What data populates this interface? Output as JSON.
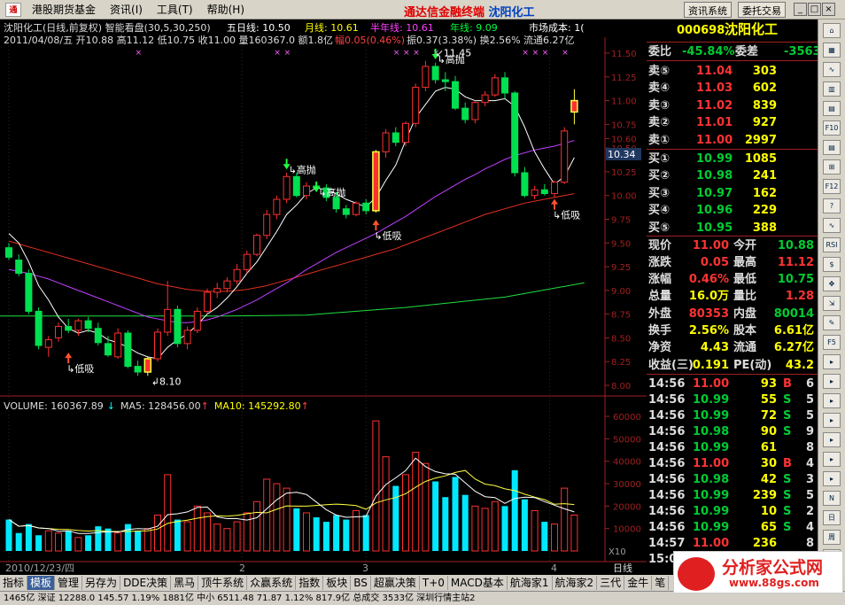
{
  "titlebar": {
    "menus": [
      "港股期货基金",
      "资讯(I)",
      "工具(T)",
      "帮助(H)"
    ],
    "title": "通达信金融终端",
    "stock": "沈阳化工",
    "btn_news": "资讯系统",
    "btn_trade": "委托交易"
  },
  "header": {
    "line1": "沈阳化工(日线,前复权) 智能看盘(30,5,30,250)",
    "ma5": "五日线: 10.50",
    "ma20": "月线: 10.61",
    "ma120": "半年线: 10.61",
    "ma250": "年线: 9.09",
    "cost": "市场成本: 1(",
    "line2a": "2011/04/08/五 开10.88 高11.12 低10.75 收11.00 量160367.0 额1.8亿",
    "line2b": "幅0.05(0.46%)",
    "line2c": "振0.37(3.38%) 换2.56% 流通6.27亿"
  },
  "price_axis": [
    "11.50",
    "11.25",
    "11.00",
    "10.75",
    "10.60",
    "10.50",
    "10.25",
    "10.00",
    "9.75",
    "9.50",
    "9.25",
    "9.00",
    "8.75",
    "8.50",
    "8.25",
    "8.00"
  ],
  "price_tag": "10.34",
  "vol_axis": [
    "60000",
    "50000",
    "40000",
    "30000",
    "20000",
    "10000"
  ],
  "vol_unit": "X10",
  "vol_header": {
    "a": "VOLUME: 160367.89",
    "b": "MA5: 128456.00",
    "c": "MA10: 145292.80"
  },
  "dates": {
    "first": "2010/12/23/四",
    "m2": "2",
    "m3": "3",
    "m4": "4"
  },
  "annotations": {
    "low": "低吸",
    "high": "高抛",
    "top": "11.45",
    "bottom": "8.10"
  },
  "chart_data": {
    "type": "candlestick",
    "candles": [
      [
        9.45,
        9.5,
        9.32,
        9.35
      ],
      [
        9.32,
        9.38,
        9.15,
        9.18
      ],
      [
        9.18,
        9.22,
        8.75,
        8.78
      ],
      [
        8.78,
        8.82,
        8.38,
        8.42
      ],
      [
        8.4,
        8.52,
        8.3,
        8.48
      ],
      [
        8.5,
        8.66,
        8.46,
        8.62
      ],
      [
        8.62,
        8.7,
        8.55,
        8.58
      ],
      [
        8.58,
        8.7,
        8.52,
        8.68
      ],
      [
        8.68,
        8.72,
        8.56,
        8.6
      ],
      [
        8.6,
        8.66,
        8.42,
        8.45
      ],
      [
        8.44,
        8.52,
        8.3,
        8.32
      ],
      [
        8.3,
        8.6,
        8.28,
        8.55
      ],
      [
        8.55,
        8.58,
        8.18,
        8.2
      ],
      [
        8.2,
        8.26,
        8.1,
        8.14
      ],
      [
        8.14,
        8.3,
        8.1,
        8.28
      ],
      [
        8.28,
        8.6,
        8.25,
        8.56
      ],
      [
        8.56,
        9.1,
        8.52,
        8.8
      ],
      [
        8.8,
        8.84,
        8.4,
        8.44
      ],
      [
        8.44,
        8.62,
        8.38,
        8.58
      ],
      [
        8.58,
        8.82,
        8.55,
        8.78
      ],
      [
        8.78,
        9.02,
        8.75,
        8.98
      ],
      [
        8.98,
        9.08,
        8.92,
        9.02
      ],
      [
        9.02,
        9.14,
        8.98,
        9.1
      ],
      [
        9.1,
        9.28,
        9.06,
        9.22
      ],
      [
        9.22,
        9.42,
        9.18,
        9.38
      ],
      [
        9.38,
        9.6,
        9.36,
        9.58
      ],
      [
        9.58,
        9.85,
        9.54,
        9.8
      ],
      [
        9.8,
        10.0,
        9.75,
        9.96
      ],
      [
        9.96,
        10.24,
        9.92,
        10.2
      ],
      [
        10.2,
        10.24,
        9.98,
        10.0
      ],
      [
        10.0,
        10.14,
        9.96,
        10.1
      ],
      [
        10.1,
        10.14,
        10.04,
        10.08
      ],
      [
        10.08,
        10.12,
        9.94,
        9.98
      ],
      [
        9.98,
        10.04,
        9.82,
        9.86
      ],
      [
        9.86,
        9.9,
        9.76,
        9.8
      ],
      [
        9.8,
        9.94,
        9.78,
        9.92
      ],
      [
        9.92,
        9.96,
        9.8,
        9.84
      ],
      [
        9.84,
        10.48,
        9.82,
        10.46
      ],
      [
        10.46,
        10.7,
        10.4,
        10.66
      ],
      [
        10.66,
        10.72,
        10.52,
        10.56
      ],
      [
        10.56,
        10.78,
        10.52,
        10.76
      ],
      [
        10.76,
        11.18,
        10.72,
        11.14
      ],
      [
        11.14,
        11.42,
        11.1,
        11.36
      ],
      [
        11.36,
        11.4,
        11.18,
        11.22
      ],
      [
        11.22,
        11.3,
        11.1,
        11.2
      ],
      [
        11.2,
        11.26,
        10.9,
        10.92
      ],
      [
        10.92,
        10.98,
        10.76,
        10.8
      ],
      [
        10.8,
        11.0,
        10.76,
        10.98
      ],
      [
        10.98,
        11.1,
        10.94,
        11.06
      ],
      [
        11.06,
        11.28,
        11.04,
        11.24
      ],
      [
        11.24,
        11.3,
        11.02,
        11.08
      ],
      [
        11.08,
        11.1,
        10.2,
        10.24
      ],
      [
        10.24,
        10.3,
        9.98,
        10.0
      ],
      [
        10.0,
        10.1,
        9.96,
        10.06
      ],
      [
        10.06,
        10.12,
        10.0,
        10.02
      ],
      [
        10.02,
        10.16,
        9.98,
        10.14
      ],
      [
        10.14,
        10.72,
        10.12,
        10.68
      ],
      [
        10.88,
        11.12,
        10.75,
        11.0
      ]
    ],
    "ma5": [
      9.6,
      9.5,
      9.3,
      9.05,
      8.9,
      8.72,
      8.6,
      8.55,
      8.58,
      8.55,
      8.48,
      8.45,
      8.4,
      8.34,
      8.3,
      8.28,
      8.4,
      8.48,
      8.54,
      8.64,
      8.75,
      8.82,
      8.92,
      9.04,
      9.18,
      9.3,
      9.46,
      9.62,
      9.8,
      9.9,
      10.02,
      10.08,
      10.06,
      10.02,
      9.96,
      9.92,
      9.88,
      9.98,
      10.16,
      10.32,
      10.58,
      10.82,
      10.96,
      11.1,
      11.14,
      11.12,
      11.04,
      11.0,
      11.0,
      11.0,
      11.02,
      10.94,
      10.72,
      10.46,
      10.28,
      10.12,
      10.2,
      10.4
    ],
    "ma30": [
      9.22,
      9.2,
      9.18,
      9.15,
      9.12,
      9.08,
      9.04,
      9.0,
      8.96,
      8.92,
      8.88,
      8.84,
      8.8,
      8.76,
      8.72,
      8.7,
      8.68,
      8.66,
      8.66,
      8.67,
      8.69,
      8.72,
      8.76,
      8.8,
      8.85,
      8.9,
      8.96,
      9.02,
      9.08,
      9.15,
      9.22,
      9.28,
      9.34,
      9.4,
      9.45,
      9.5,
      9.55,
      9.6,
      9.66,
      9.72,
      9.78,
      9.85,
      9.92,
      9.99,
      10.05,
      10.11,
      10.17,
      10.22,
      10.28,
      10.33,
      10.38,
      10.42,
      10.45,
      10.48,
      10.5,
      10.52,
      10.55,
      10.58
    ],
    "ma_red": [
      9.52,
      9.49,
      9.46,
      9.43,
      9.4,
      9.37,
      9.34,
      9.31,
      9.28,
      9.25,
      9.22,
      9.19,
      9.16,
      9.13,
      9.1,
      9.07,
      9.05,
      9.03,
      9.01,
      9.0,
      8.99,
      8.99,
      8.99,
      9.0,
      9.01,
      9.03,
      9.05,
      9.08,
      9.11,
      9.14,
      9.17,
      9.2,
      9.23,
      9.26,
      9.29,
      9.32,
      9.35,
      9.38,
      9.41,
      9.44,
      9.48,
      9.52,
      9.56,
      9.6,
      9.64,
      9.68,
      9.72,
      9.76,
      9.8,
      9.83,
      9.86,
      9.89,
      9.92,
      9.94,
      9.96,
      9.98,
      10.0,
      10.02
    ],
    "ma_green": [
      [
        0,
        8.73
      ],
      [
        22,
        8.73
      ],
      [
        30,
        8.74
      ],
      [
        40,
        8.82
      ],
      [
        50,
        8.93
      ],
      [
        58,
        9.08
      ]
    ],
    "volume": [
      14000,
      8000,
      12000,
      7000,
      9000,
      8000,
      9000,
      6000,
      7000,
      11000,
      10000,
      8000,
      12000,
      9000,
      10000,
      16000,
      34000,
      14000,
      13000,
      20000,
      17000,
      12000,
      10000,
      13000,
      17000,
      22000,
      32000,
      30000,
      28000,
      19000,
      17000,
      15000,
      13000,
      16000,
      14000,
      18000,
      16000,
      58000,
      42000,
      29000,
      34000,
      44000,
      39000,
      31000,
      24000,
      33000,
      25000,
      20000,
      19000,
      22000,
      20000,
      36000,
      23000,
      18000,
      13000,
      12000,
      28000,
      16000
    ]
  },
  "quote": {
    "code": "000698",
    "name": "沈阳化工",
    "wb_label": "委比",
    "wb": "-45.84%",
    "wc_label": "委差",
    "wc": "-3563",
    "sells": [
      {
        "l": "卖⑤",
        "p": "11.04",
        "v": "303"
      },
      {
        "l": "卖④",
        "p": "11.03",
        "v": "602"
      },
      {
        "l": "卖③",
        "p": "11.02",
        "v": "839"
      },
      {
        "l": "卖②",
        "p": "11.01",
        "v": "927"
      },
      {
        "l": "卖①",
        "p": "11.00",
        "v": "2997"
      }
    ],
    "buys": [
      {
        "l": "买①",
        "p": "10.99",
        "v": "1085"
      },
      {
        "l": "买②",
        "p": "10.98",
        "v": "241"
      },
      {
        "l": "买③",
        "p": "10.97",
        "v": "162"
      },
      {
        "l": "买④",
        "p": "10.96",
        "v": "229"
      },
      {
        "l": "买⑤",
        "p": "10.95",
        "v": "388"
      }
    ],
    "stats": [
      {
        "l1": "现价",
        "v1": "11.00",
        "c1": "up",
        "l2": "今开",
        "v2": "10.88",
        "c2": "dn"
      },
      {
        "l1": "涨跌",
        "v1": "0.05",
        "c1": "up",
        "l2": "最高",
        "v2": "11.12",
        "c2": "up"
      },
      {
        "l1": "涨幅",
        "v1": "0.46%",
        "c1": "up",
        "l2": "最低",
        "v2": "10.75",
        "c2": "dn"
      },
      {
        "l1": "总量",
        "v1": "16.0万",
        "c1": "yl",
        "l2": "量比",
        "v2": "1.28",
        "c2": "up"
      },
      {
        "l1": "外盘",
        "v1": "80353",
        "c1": "up",
        "l2": "内盘",
        "v2": "80014",
        "c2": "dn"
      },
      {
        "l1": "换手",
        "v1": "2.56%",
        "c1": "yl",
        "l2": "股本",
        "v2": "6.61亿",
        "c2": "yl"
      },
      {
        "l1": "净资",
        "v1": "4.43",
        "c1": "yl",
        "l2": "流通",
        "v2": "6.27亿",
        "c2": "yl"
      },
      {
        "l1": "收益(三)",
        "v1": "0.191",
        "c1": "yl",
        "l2": "PE(动)",
        "v2": "43.2",
        "c2": "yl"
      }
    ],
    "ticks": [
      {
        "t": "14:56",
        "p": "11.00",
        "v": "93",
        "d": "B",
        "n": "6"
      },
      {
        "t": "14:56",
        "p": "10.99",
        "v": "55",
        "d": "S",
        "n": "5"
      },
      {
        "t": "14:56",
        "p": "10.99",
        "v": "72",
        "d": "S",
        "n": "5"
      },
      {
        "t": "14:56",
        "p": "10.98",
        "v": "90",
        "d": "S",
        "n": "9"
      },
      {
        "t": "14:56",
        "p": "10.99",
        "v": "61",
        "d": "",
        "n": "8"
      },
      {
        "t": "14:56",
        "p": "11.00",
        "v": "30",
        "d": "B",
        "n": "4"
      },
      {
        "t": "14:56",
        "p": "10.98",
        "v": "42",
        "d": "S",
        "n": "3"
      },
      {
        "t": "14:56",
        "p": "10.99",
        "v": "239",
        "d": "S",
        "n": "5"
      },
      {
        "t": "14:56",
        "p": "10.99",
        "v": "10",
        "d": "S",
        "n": "2"
      },
      {
        "t": "14:56",
        "p": "10.99",
        "v": "65",
        "d": "S",
        "n": "4"
      },
      {
        "t": "14:57",
        "p": "11.00",
        "v": "236",
        "d": "",
        "n": "8"
      },
      {
        "t": "15:00",
        "p": "11.00",
        "v": "",
        "d": "",
        "n": ""
      }
    ]
  },
  "toolbar_right": [
    "⌂",
    "▦",
    "∿",
    "▥",
    "▤",
    "F10",
    "▤",
    "⊞",
    "F12",
    "?",
    "∿",
    "RSI",
    "$",
    "✥",
    "⇲",
    "✎",
    "F5",
    "▸",
    "▸",
    "▸",
    "▸",
    "▸",
    "▸",
    "▸",
    "N",
    "日",
    "周",
    "月"
  ],
  "bottom_tabs": [
    "指标",
    "模板",
    "管理",
    "另存为",
    "DDE决策",
    "黑马",
    "顶牛系统",
    "众赢系统",
    "指数",
    "板块",
    "BS",
    "超赢决策",
    "T+0",
    "MACD基本",
    "航海家1",
    "航海家2",
    "三代",
    "金牛",
    "笔"
  ],
  "bottom_right": "日线",
  "status": "1465亿  深证 12288.0  145.57  1.19%   1881亿  中小 6511.48  71.87  1.12%   817.9亿  总成交   3533亿  深圳行情主站2",
  "watermark": {
    "a": "分析家公式网",
    "b": "www.88gs.com"
  }
}
